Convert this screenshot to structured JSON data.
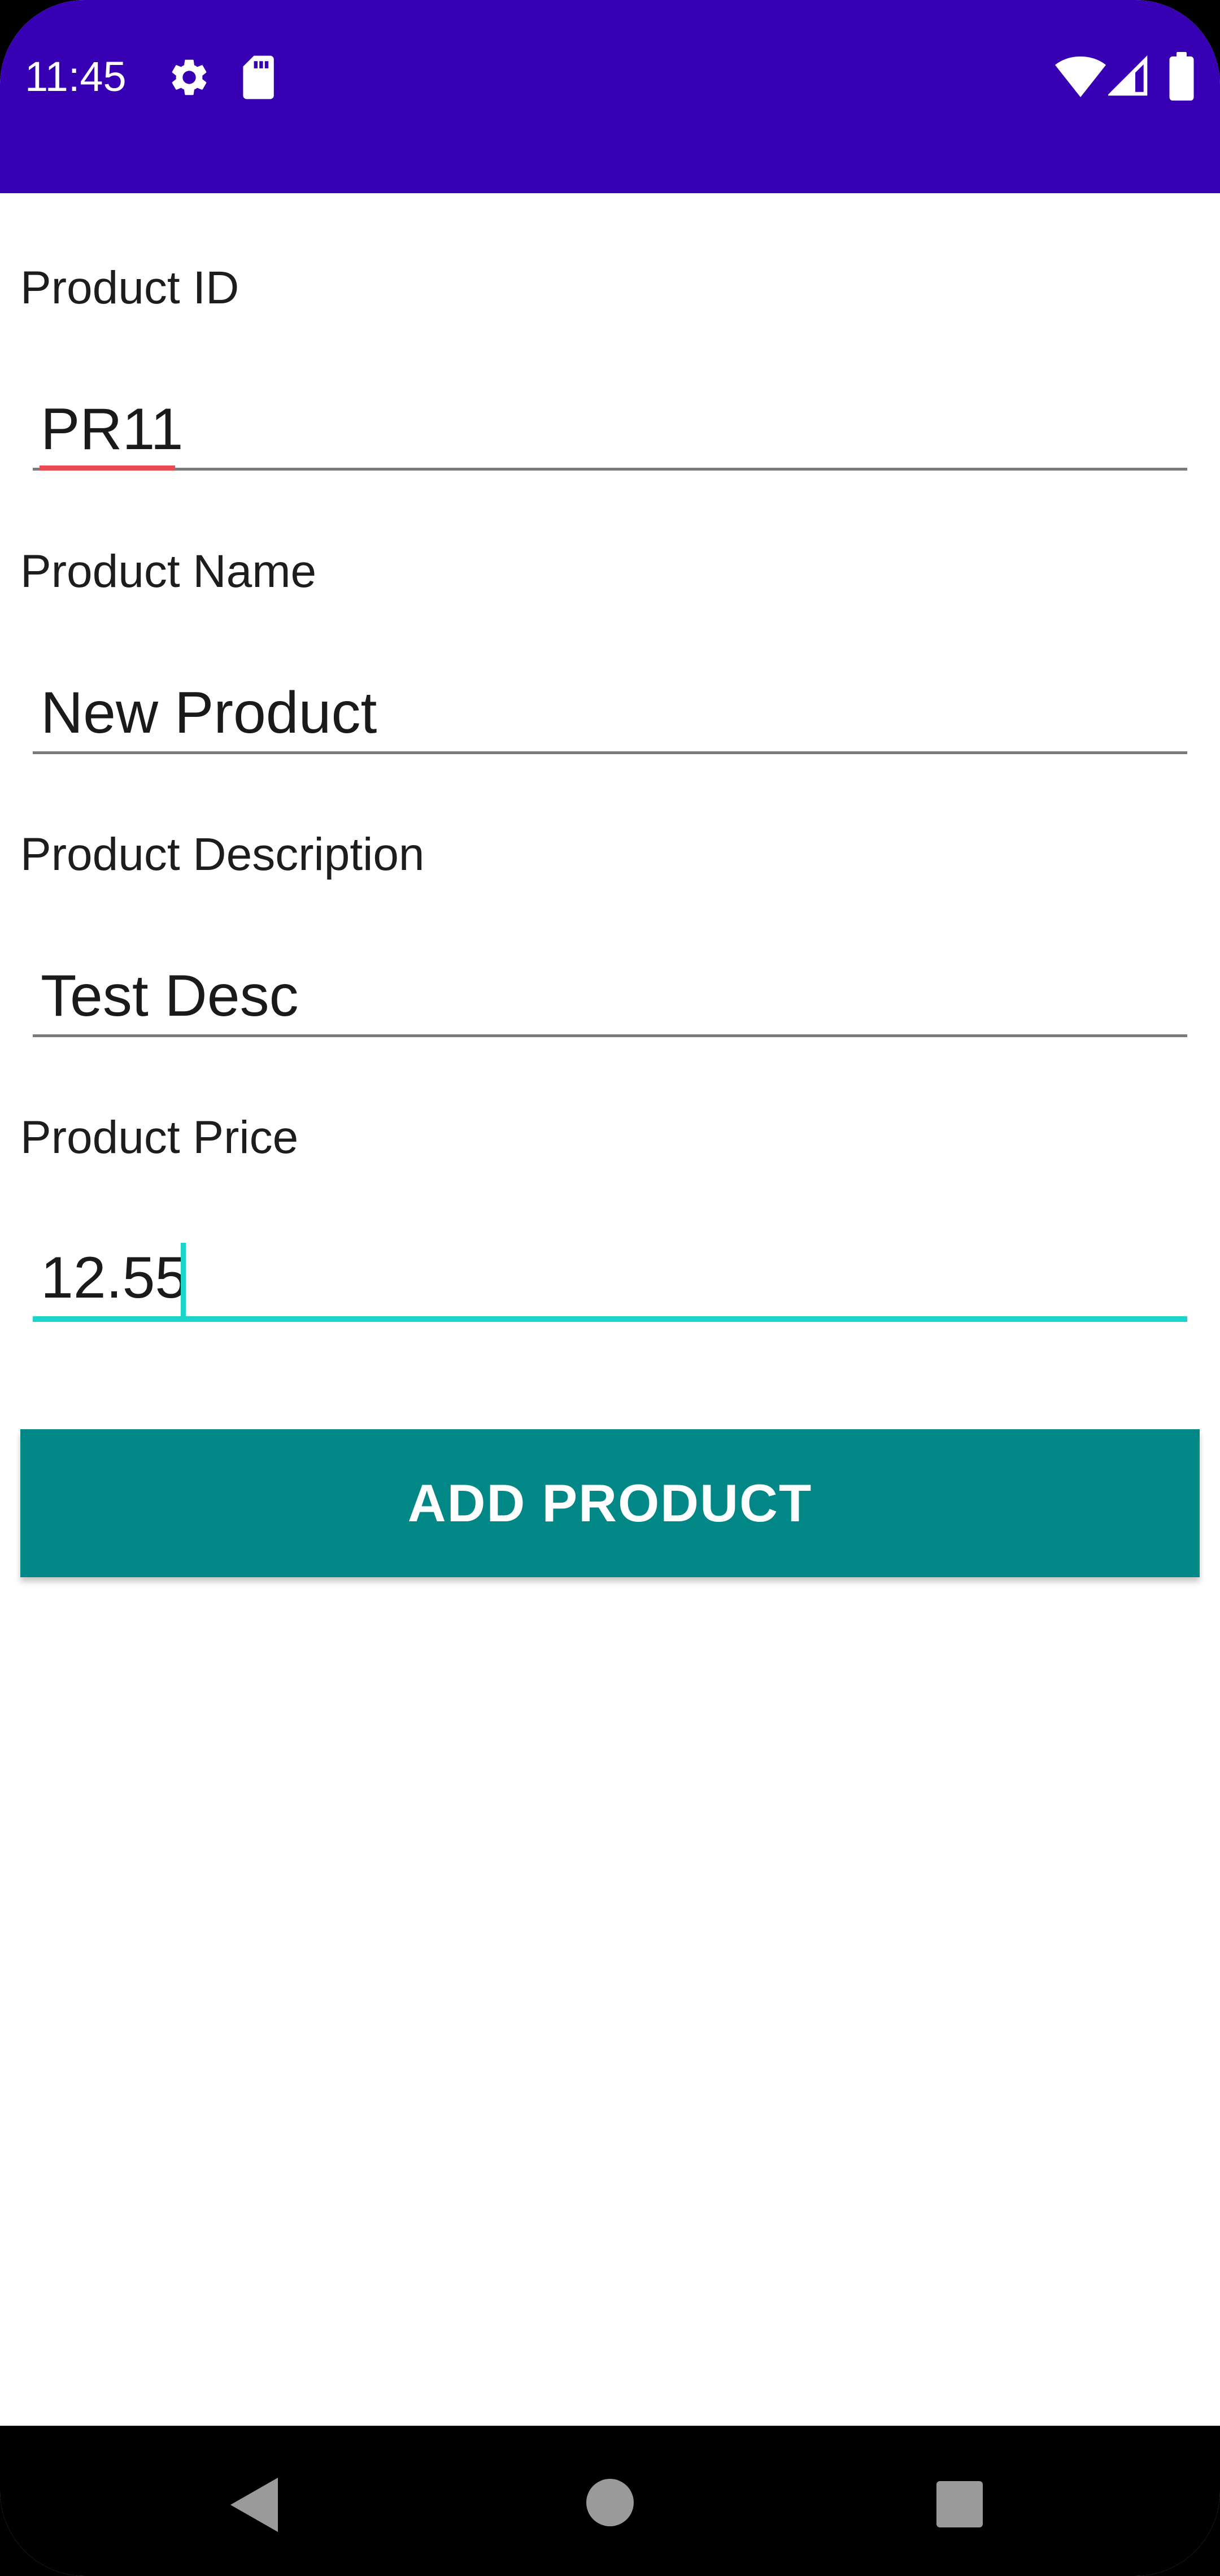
{
  "status_bar": {
    "time": "11:45",
    "icons": [
      "gear-icon",
      "sd-card-icon",
      "wifi-icon",
      "signal-icon",
      "battery-icon"
    ]
  },
  "form": {
    "product_id": {
      "label": "Product ID",
      "value": "PR11"
    },
    "product_name": {
      "label": "Product Name",
      "value": "New Product"
    },
    "product_description": {
      "label": "Product Description",
      "value": "Test Desc"
    },
    "product_price": {
      "label": "Product Price",
      "value": "12.55"
    }
  },
  "actions": {
    "add_product_label": "ADD PRODUCT"
  },
  "nav_bar": {
    "icons": [
      "back-icon",
      "home-icon",
      "recents-icon"
    ]
  },
  "colors": {
    "app_bar": "#3700b3",
    "button": "#018786",
    "focus_accent": "#19d6c8",
    "spellcheck": "#e84b54",
    "nav_bar": "#000000"
  }
}
